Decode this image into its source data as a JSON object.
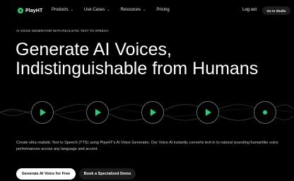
{
  "nav": {
    "brand": "PlayHT",
    "menu": [
      {
        "label": "Products",
        "caret": "⌄"
      },
      {
        "label": "Use Cases",
        "caret": "⌄"
      },
      {
        "label": "Resources",
        "caret": "⌄"
      },
      {
        "label": "Pricing",
        "caret": ""
      }
    ],
    "login": "Log out",
    "dashboard": "Go to Studio"
  },
  "hero": {
    "eyebrow": "AI VOICE GENERATOR WITH REALISTIC TEXT TO SPEECH",
    "title_line1": "Generate AI Voices,",
    "title_line2": "Indistinguishable from Humans",
    "description": "Create ultra realistic Text to Speech (TTS) using PlayHT's AI Voice Generator. Our Voice AI instantly converts text in to natural sounding humanlike voice performances across any language and accent.",
    "primary_cta": "Generate AI Voice for Free",
    "secondary_cta": "Book a Specialized Demo"
  },
  "players": [
    {
      "icon": "play-icon"
    },
    {
      "icon": "play-icon"
    },
    {
      "icon": "play-icon"
    },
    {
      "icon": "play-icon"
    },
    {
      "icon": "dot-icon"
    }
  ],
  "colors": {
    "background": "#000000",
    "accent": "#1fd47a",
    "primary_button": "#ffffff",
    "secondary_button": "#1c1c1c"
  }
}
